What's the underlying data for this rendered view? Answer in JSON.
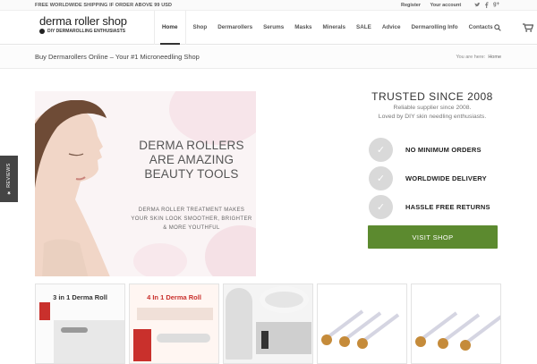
{
  "topbar": {
    "shipping": "FREE WORLDWIDE SHIPPING IF ORDER ABOVE 99 USD",
    "register": "Register",
    "account": "Your account",
    "social": [
      "twitter-icon",
      "facebook-icon",
      "gplus-icon"
    ]
  },
  "header": {
    "logo_name": "derma roller shop",
    "logo_tagline": "DIY DERMAROLLING ENTHUSIASTS",
    "nav": [
      "Home",
      "Shop",
      "Dermarollers",
      "Serums",
      "Masks",
      "Minerals",
      "SALE",
      "Advice",
      "Dermarolling Info",
      "Contacts"
    ],
    "active": "Home"
  },
  "title_bar": {
    "title": "Buy Dermarollers Online – Your #1 Microneedling Shop",
    "breadcrumb_prefix": "You are here:",
    "breadcrumb_home": "Home"
  },
  "reviews_tab": "★ REVIEWS",
  "hero": {
    "heading_line1": "DERMA ROLLERS",
    "heading_line2": "ARE AMAZING",
    "heading_line3": "BEAUTY TOOLS",
    "sub_line1": "DERMA ROLLER TREATMENT MAKES",
    "sub_line2": "YOUR SKIN LOOK SMOOTHER, BRIGHTER",
    "sub_line3": "& MORE YOUTHFUL"
  },
  "trusted": {
    "title": "TRUSTED SINCE 2008",
    "line1": "Reliable supplier since 2008.",
    "line2": "Loved by DIY skin needling enthusiasts."
  },
  "features": [
    "NO MINIMUM ORDERS",
    "WORLDWIDE DELIVERY",
    "HASSLE FREE RETURNS"
  ],
  "cta": "VISIT SHOP",
  "products": [
    {
      "label": "3 in 1 Derma Roll"
    },
    {
      "label": "4 In 1 Derma Roll"
    },
    {
      "label": ""
    },
    {
      "label": ""
    },
    {
      "label": ""
    }
  ],
  "colors": {
    "accent_green": "#5c8a2f",
    "check_grey": "#d9d9d9"
  }
}
